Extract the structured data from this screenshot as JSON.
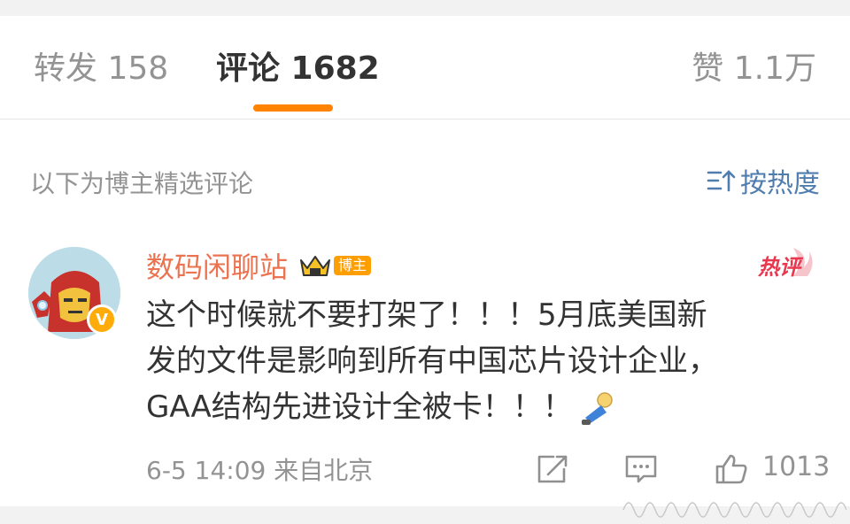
{
  "tabs": [
    {
      "label": "转发 158"
    },
    {
      "label": "评论 1682"
    },
    {
      "label": "赞 1.1万"
    }
  ],
  "filter": {
    "label": "以下为博主精选评论",
    "sort_label": "按热度"
  },
  "comment": {
    "username": "数码闲聊站",
    "badge": "博主",
    "verified_mark": "V",
    "hot_tag": "热评",
    "lines": [
      "这个时候就不要打架了！！！5月底美国新",
      "发的文件是影响到所有中国芯片设计企业，",
      "GAA结构先进设计全被卡！！！"
    ],
    "time_location": "6-5 14:09  来自北京",
    "like_count": "1013"
  },
  "colors": {
    "accent": "#ff8200",
    "username": "#eb7350",
    "link": "#507daf",
    "hot": "#e8384f"
  }
}
